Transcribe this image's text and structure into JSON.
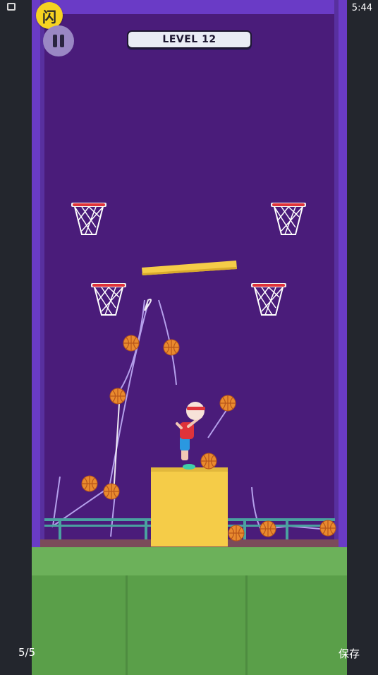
{
  "status_bar": {
    "time": "5:44"
  },
  "app_badge": {
    "glyph": "闪"
  },
  "hud": {
    "level_label": "LEVEL 12"
  },
  "footer": {
    "page_counter": "5/5",
    "save_label": "保存"
  },
  "colors": {
    "wall": "#4a1c7a",
    "frame": "#6a3bc6",
    "pedestal": "#f5cc48",
    "ball": "#e98a2e",
    "ground": "#6cb15a",
    "hoop_rim": "#e0333a"
  },
  "icons": [
    "pause-icon",
    "wifi-icon",
    "battery-icon",
    "image-icon",
    "basketball-icon",
    "hoop-icon"
  ]
}
